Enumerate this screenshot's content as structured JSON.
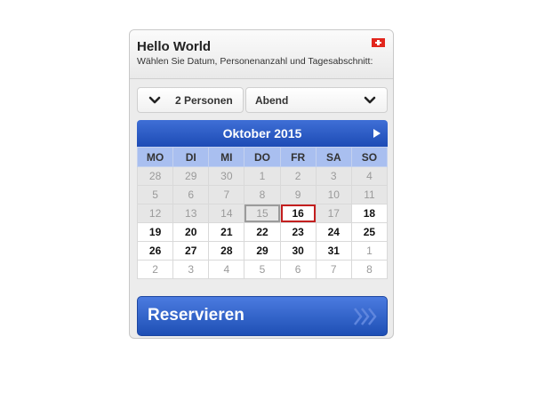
{
  "header": {
    "title": "Hello World",
    "subtitle": "Wählen Sie Datum, Personenanzahl und Tagesabschnitt:",
    "flag_icon": "swiss-flag-icon"
  },
  "persons_select": {
    "label": "2 Personen"
  },
  "time_select": {
    "label": "Abend"
  },
  "calendar": {
    "month_title": "Oktober 2015",
    "weekdays": [
      "MO",
      "DI",
      "MI",
      "DO",
      "FR",
      "SA",
      "SO"
    ],
    "weeks": [
      [
        {
          "d": "28",
          "s": "disabled"
        },
        {
          "d": "29",
          "s": "disabled"
        },
        {
          "d": "30",
          "s": "disabled"
        },
        {
          "d": "1",
          "s": "disabled"
        },
        {
          "d": "2",
          "s": "disabled"
        },
        {
          "d": "3",
          "s": "disabled"
        },
        {
          "d": "4",
          "s": "disabled"
        }
      ],
      [
        {
          "d": "5",
          "s": "disabled"
        },
        {
          "d": "6",
          "s": "disabled"
        },
        {
          "d": "7",
          "s": "disabled"
        },
        {
          "d": "8",
          "s": "disabled"
        },
        {
          "d": "9",
          "s": "disabled"
        },
        {
          "d": "10",
          "s": "disabled"
        },
        {
          "d": "11",
          "s": "disabled"
        }
      ],
      [
        {
          "d": "12",
          "s": "disabled"
        },
        {
          "d": "13",
          "s": "disabled"
        },
        {
          "d": "14",
          "s": "disabled"
        },
        {
          "d": "15",
          "s": "today"
        },
        {
          "d": "16",
          "s": "selected"
        },
        {
          "d": "17",
          "s": "disabled"
        },
        {
          "d": "18",
          "s": "available"
        }
      ],
      [
        {
          "d": "19",
          "s": "available"
        },
        {
          "d": "20",
          "s": "available"
        },
        {
          "d": "21",
          "s": "available"
        },
        {
          "d": "22",
          "s": "available"
        },
        {
          "d": "23",
          "s": "available"
        },
        {
          "d": "24",
          "s": "available"
        },
        {
          "d": "25",
          "s": "available"
        }
      ],
      [
        {
          "d": "26",
          "s": "available"
        },
        {
          "d": "27",
          "s": "available"
        },
        {
          "d": "28",
          "s": "available"
        },
        {
          "d": "29",
          "s": "available"
        },
        {
          "d": "30",
          "s": "available"
        },
        {
          "d": "31",
          "s": "available"
        },
        {
          "d": "1",
          "s": "other"
        }
      ],
      [
        {
          "d": "2",
          "s": "other"
        },
        {
          "d": "3",
          "s": "other"
        },
        {
          "d": "4",
          "s": "other"
        },
        {
          "d": "5",
          "s": "other"
        },
        {
          "d": "6",
          "s": "other"
        },
        {
          "d": "7",
          "s": "other"
        },
        {
          "d": "8",
          "s": "other"
        }
      ]
    ]
  },
  "reserve_button": {
    "label": "Reservieren"
  },
  "colors": {
    "accent": "#2454c3",
    "weekday_bg": "#a9bff0",
    "selected_border": "#c31f1f"
  }
}
